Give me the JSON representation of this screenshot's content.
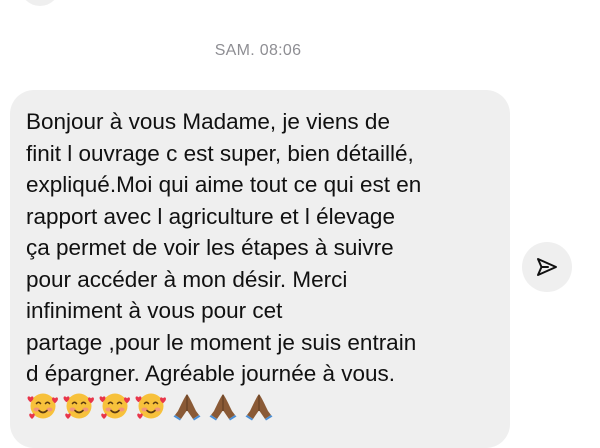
{
  "conversation": {
    "timestamp": "SAM. 08:06",
    "message": {
      "text": "Bonjour à vous Madame, je viens de\nfinit l ouvrage c est super, bien détaillé,\nexpliqué.Moi qui aime tout ce qui est en\nrapport avec l agriculture et l élevage\nça permet de voir les étapes à suivre\npour accéder à mon désir. Merci\ninfiniment à vous pour cet\npartage ,pour le moment je suis entrain\nd épargner. Agréable journée à vous.",
      "emojis": [
        "smiling-face-with-hearts-icon",
        "smiling-face-with-hearts-icon",
        "smiling-face-with-hearts-icon",
        "smiling-face-with-hearts-icon",
        "folded-hands-icon",
        "folded-hands-icon",
        "folded-hands-icon"
      ]
    },
    "share_icon": "paper-plane-icon"
  },
  "colors": {
    "bubble_background": "#efefef",
    "message_text": "#111111",
    "timestamp_text": "#8e8e93",
    "emoji_face": "#f7c13b",
    "emoji_heart": "#e8354a",
    "emoji_hands": "#8a5a36"
  }
}
